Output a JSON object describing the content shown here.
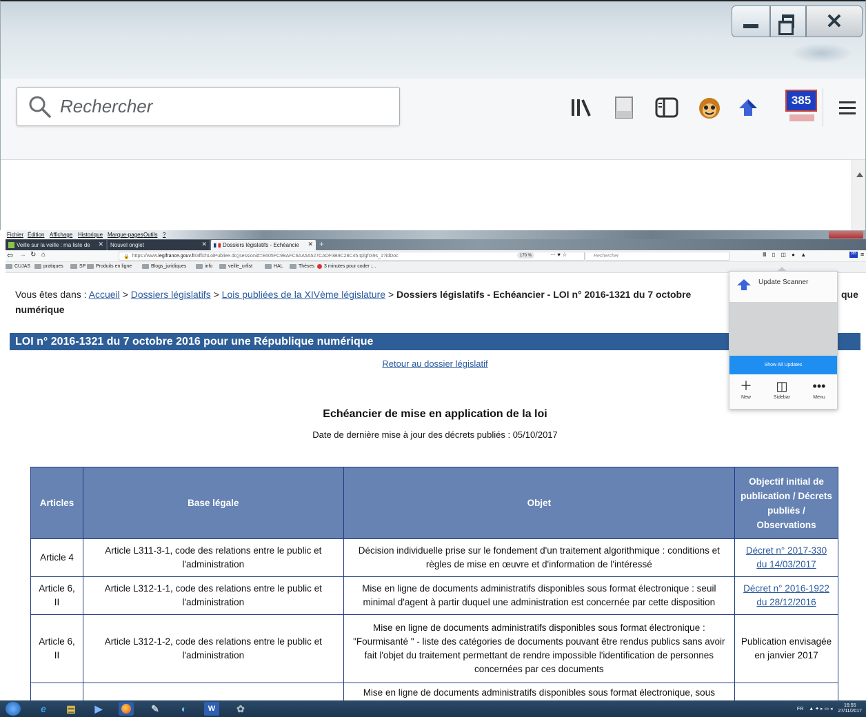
{
  "zoom": {
    "search_placeholder": "Rechercher",
    "badge": "385"
  },
  "menubar": [
    "Fichier",
    "Édition",
    "Affichage",
    "Historique",
    "Marque-pages",
    "Outils",
    "?"
  ],
  "tabs": [
    {
      "label": "Veille sur la veille : ma liste de"
    },
    {
      "label": "Nouvel onglet"
    },
    {
      "label": "Dossiers législatifs - Echéancie"
    }
  ],
  "url": {
    "prefix": "https://www.",
    "domain": "legifrance.gouv.fr",
    "path": "/affichLoiPubliee.do;jsessionid=E605FC9BAFC6AA5A527CADF3B9C28C45.tplgfr39s_1?idDoc",
    "zoom": "170 %",
    "search_placeholder": "Rechercher"
  },
  "mini_badge": "385",
  "bookmarks": [
    "CUJAS",
    "pratiques",
    "SP",
    "Produits en ligne",
    "Blogs_juridiques",
    "info",
    "veille_urfist",
    "HAL",
    "Thèses",
    "3 minutes pour coder :..."
  ],
  "breadcrumb": {
    "prefix": "Vous êtes dans :",
    "l1": "Accueil",
    "l2": "Dossiers législatifs",
    "l3": "Lois publiées de la XIVème législature",
    "current": "Dossiers législatifs - Echéancier - LOI n° 2016-1321 du 7 octobre",
    "current_tail": "que",
    "current_line2": "numérique",
    "sep": ">"
  },
  "page_title": "LOI n° 2016-1321 du 7 octobre 2016 pour une République numérique",
  "retour": "Retour au dossier législatif",
  "echeancier_title": "Echéancier de mise en application de la loi",
  "echeancier_date": "Date de dernière mise à jour des décrets publiés : 05/10/2017",
  "table": {
    "headers": [
      "Articles",
      "Base légale",
      "Objet",
      "Objectif initial de publication / Décrets publiés / Observations"
    ],
    "rows": [
      {
        "article": "Article 4",
        "base": "Article L311-3-1, code des relations entre le public et l'administration",
        "objet": "Décision individuelle prise sur le fondement d'un traitement algorithmique : conditions et règles de mise en œuvre et d'information de l'intéressé",
        "obs": "Décret n° 2017-330 du 14/03/2017"
      },
      {
        "article": "Article 6, II",
        "base": "Article L312-1-1, code des relations entre le public et l'administration",
        "objet": "Mise en ligne de documents administratifs disponibles sous format électronique : seuil minimal d'agent à partir duquel une administration est concernée par cette disposition",
        "obs": "Décret n° 2016-1922 du 28/12/2016"
      },
      {
        "article": "Article 6, II",
        "base": "Article L312-1-2, code des relations entre le public et l'administration",
        "objet": "Mise en ligne de documents administratifs disponibles sous format électronique : \"Fourmisanté \" - liste des catégories de documents pouvant être rendus publics sans avoir fait l'objet du traitement permettant de rendre impossible l'identification de personnes concernées par ces documents",
        "obs": "Publication envisagée en janvier 2017"
      },
      {
        "article": "",
        "base": "",
        "objet": "Mise en ligne de documents administratifs disponibles sous format électronique, sous",
        "obs": ""
      }
    ]
  },
  "popup": {
    "title": "Update Scanner",
    "show_all": "Show All Updates",
    "new": "New",
    "sidebar": "Sidebar",
    "menu": "Menu"
  },
  "tray": {
    "lang": "FR",
    "time": "16:55",
    "date": "27/11/2017"
  }
}
